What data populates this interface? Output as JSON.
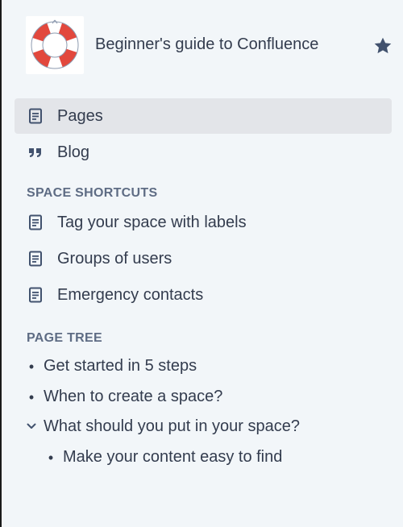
{
  "space": {
    "title": "Beginner's guide to Confluence",
    "logo_icon": "lifebuoy-logo",
    "star_icon": "star-icon",
    "logo_colors": {
      "red": "#e2483d",
      "ring": "#ffffff",
      "rope": "#8e9bb0"
    }
  },
  "nav": {
    "items": [
      {
        "label": "Pages",
        "icon": "page-icon",
        "active": true
      },
      {
        "label": "Blog",
        "icon": "quote-icon",
        "active": false
      }
    ]
  },
  "shortcuts": {
    "heading": "SPACE SHORTCUTS",
    "items": [
      {
        "label": "Tag your space with labels",
        "icon": "page-icon"
      },
      {
        "label": "Groups of users",
        "icon": "page-icon"
      },
      {
        "label": "Emergency contacts",
        "icon": "page-icon"
      }
    ]
  },
  "page_tree": {
    "heading": "PAGE TREE",
    "items": [
      {
        "label": "Get started in 5 steps",
        "marker": "•",
        "level": 0
      },
      {
        "label": "When to create a space?",
        "marker": "•",
        "level": 0
      },
      {
        "label": "What should you put in your space?",
        "marker": "chevron-down",
        "level": 0,
        "expanded": true
      },
      {
        "label": "Make your content easy to find",
        "marker": "•",
        "level": 1
      }
    ]
  },
  "colors": {
    "sidebar_bg": "#f2f6f9",
    "active_bg": "#e3e5e9",
    "text": "#333c4e",
    "heading": "#5e6c84",
    "icon": "#42526e"
  }
}
